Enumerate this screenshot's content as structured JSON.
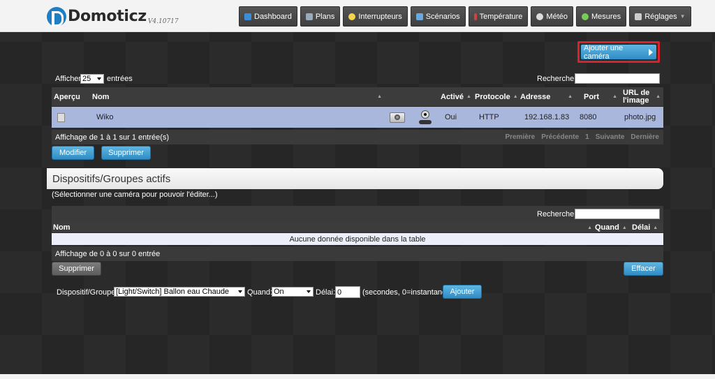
{
  "header": {
    "logo_text": "Domoticz",
    "version": "V4.10717",
    "nav": [
      {
        "label": "Dashboard",
        "icon": "dashboard-icon"
      },
      {
        "label": "Plans",
        "icon": "plans-icon"
      },
      {
        "label": "Interrupteurs",
        "icon": "lightbulb-icon"
      },
      {
        "label": "Scénarios",
        "icon": "scenes-icon"
      },
      {
        "label": "Température",
        "icon": "thermometer-icon"
      },
      {
        "label": "Météo",
        "icon": "weather-icon"
      },
      {
        "label": "Mesures",
        "icon": "utility-icon"
      },
      {
        "label": "Réglages",
        "icon": "settings-icon"
      }
    ]
  },
  "add_camera": "Ajouter une caméra",
  "camera_table": {
    "show_label": "Afficher",
    "show_value": "25",
    "entries_label": "entrées",
    "search_label": "Recherche :",
    "columns": [
      "Aperçu",
      "Nom",
      "Activé",
      "Protocole",
      "Adresse",
      "Port",
      "URL de l'image"
    ],
    "rows": [
      {
        "name": "Wiko",
        "active": "Oui",
        "protocol": "HTTP",
        "address": "192.168.1.83",
        "port": "8080",
        "url": "photo.jpg"
      }
    ],
    "info": "Affichage de 1 à 1 sur 1 entrée(s)",
    "pager": [
      "Première",
      "Précédente",
      "1",
      "Suivante",
      "Dernière"
    ],
    "modify": "Modifier",
    "delete": "Supprimer"
  },
  "devices_section": {
    "title": "Dispositifs/Groupes actifs",
    "hint": "(Sélectionner une caméra pour pouvoir l'éditer...)",
    "search_label": "Recherche :",
    "columns": [
      "Nom",
      "Quand",
      "Délai"
    ],
    "empty": "Aucune donnée disponible dans la table",
    "info": "Affichage de 0 à 0 sur 0 entrée",
    "delete": "Supprimer",
    "clear": "Effacer"
  },
  "add_form": {
    "device_label": "Dispositif/Groupe:",
    "device_value": "[Light/Switch] Ballon eau Chaude",
    "when_label": "Quand:",
    "when_value": "On",
    "delay_label": "Délai:",
    "delay_value": "0",
    "delay_hint": "(secondes, 0=instantané)",
    "add": "Ajouter"
  }
}
